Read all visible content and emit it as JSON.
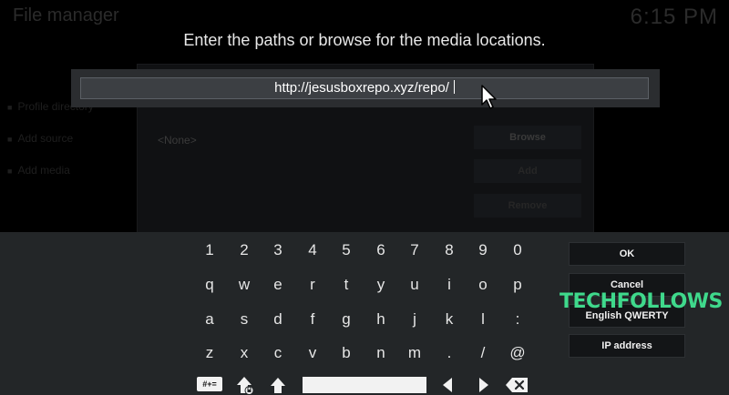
{
  "background": {
    "window_title": "File manager",
    "clock": "6:15 PM",
    "source_list": [
      "Profile directory",
      "Add source",
      "Add media"
    ],
    "source_placeholder": "<None>",
    "side_buttons": {
      "browse": "Browse",
      "add": "Add",
      "remove": "Remove"
    }
  },
  "dialog": {
    "prompt": "Enter the paths or browse for the media locations.",
    "input_value": "http://jesusboxrepo.xyz/repo/"
  },
  "keyboard": {
    "rows": [
      [
        "1",
        "2",
        "3",
        "4",
        "5",
        "6",
        "7",
        "8",
        "9",
        "0"
      ],
      [
        "q",
        "w",
        "e",
        "r",
        "t",
        "y",
        "u",
        "i",
        "o",
        "p"
      ],
      [
        "a",
        "s",
        "d",
        "f",
        "g",
        "h",
        "j",
        "k",
        "l",
        ":"
      ],
      [
        "z",
        "x",
        "c",
        "v",
        "b",
        "n",
        "m",
        ".",
        "/",
        "@"
      ]
    ],
    "symbols_label": "#+=",
    "icons": [
      "shift-lock-icon",
      "shift-icon",
      "space-bar",
      "arrow-left-icon",
      "arrow-right-icon",
      "backspace-icon"
    ]
  },
  "actions": {
    "ok": "OK",
    "cancel": "Cancel",
    "layout": "English QWERTY",
    "ip": "IP address"
  },
  "watermark": "TECHFOLLOWS",
  "colors": {
    "panel": "#232628",
    "watermark": "#3fd98c",
    "key_text": "#e6e6e6"
  }
}
